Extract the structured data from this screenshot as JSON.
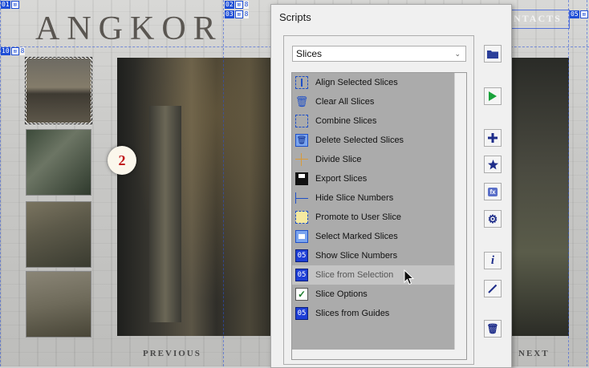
{
  "background": {
    "site_logo": "ANGKOR",
    "top_nav_right": "NTACTS",
    "nav_previous": "PREVIOUS",
    "nav_next": "NEXT",
    "badge_number": "2",
    "slice_tags": [
      {
        "num": "01",
        "sub": ""
      },
      {
        "num": "02",
        "sub": "8"
      },
      {
        "num": "03",
        "sub": "8"
      },
      {
        "num": "10",
        "sub": "8"
      },
      {
        "num": "05",
        "sub": ""
      }
    ]
  },
  "panel": {
    "title": "Scripts",
    "dropdown_value": "Slices",
    "hovered_index": 10,
    "items": [
      {
        "label": "Align Selected Slices",
        "icon": "align-slices-icon"
      },
      {
        "label": "Clear All Slices",
        "icon": "trash-icon"
      },
      {
        "label": "Combine Slices",
        "icon": "combine-slices-icon"
      },
      {
        "label": "Delete Selected Slices",
        "icon": "delete-slices-icon"
      },
      {
        "label": "Divide Slice",
        "icon": "divide-slice-icon"
      },
      {
        "label": "Export Slices",
        "icon": "save-icon"
      },
      {
        "label": "Hide Slice Numbers",
        "icon": "hide-numbers-icon"
      },
      {
        "label": "Promote to User Slice",
        "icon": "promote-slice-icon"
      },
      {
        "label": "Select Marked Slices",
        "icon": "select-marked-icon"
      },
      {
        "label": "Show Slice Numbers",
        "icon": "slice-number-icon"
      },
      {
        "label": "Slice from Selection",
        "icon": "slice-number-icon"
      },
      {
        "label": "Slice Options",
        "icon": "checkbox-icon"
      },
      {
        "label": "Slices from Guides",
        "icon": "slice-number-icon"
      }
    ],
    "side_buttons": [
      {
        "name": "open-folder-button",
        "icon": "folder-icon"
      },
      {
        "name": "run-script-button",
        "icon": "play-icon"
      },
      {
        "name": "add-script-button",
        "icon": "plus-icon"
      },
      {
        "name": "favorite-button",
        "icon": "star-icon"
      },
      {
        "name": "fx-button",
        "icon": "fx-icon"
      },
      {
        "name": "settings-button",
        "icon": "gear-icon"
      },
      {
        "name": "info-button",
        "icon": "info-icon"
      },
      {
        "name": "edit-button",
        "icon": "pencil-icon"
      },
      {
        "name": "delete-button",
        "icon": "trash-icon"
      }
    ]
  },
  "colors": {
    "slice_blue": "#1f4fd6",
    "list_background": "#ababab",
    "run_green": "#18a23a",
    "badge_red": "#c0161a"
  }
}
